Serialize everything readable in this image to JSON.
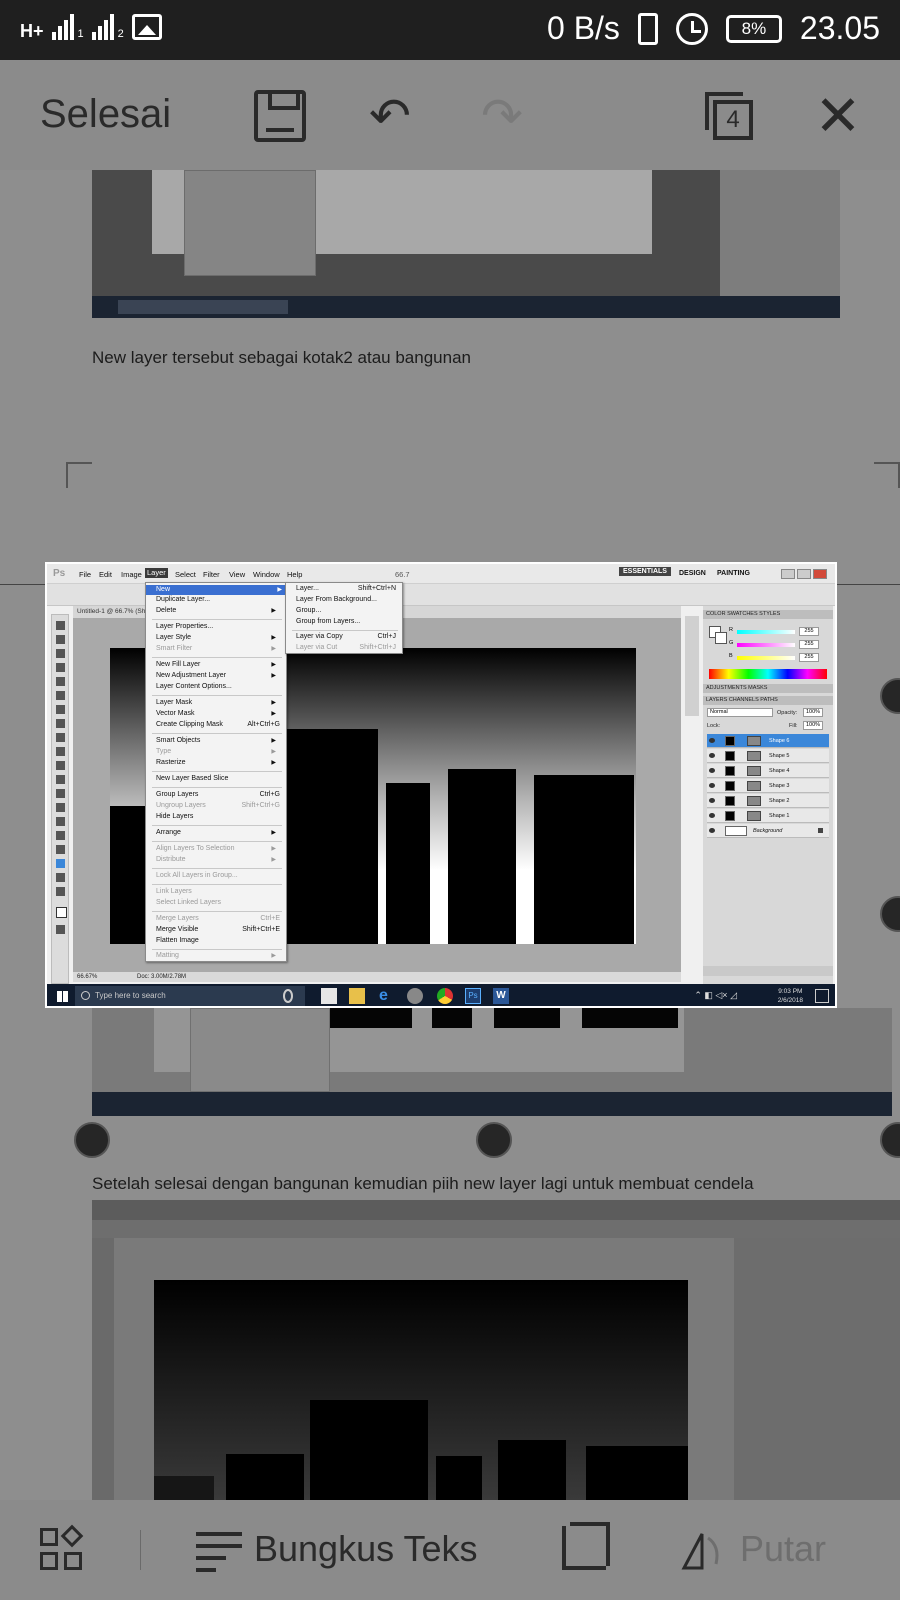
{
  "status_bar": {
    "network": "H+",
    "sim1": "1",
    "sim2": "2",
    "speed": "0 B/s",
    "battery": "8%",
    "time": "23.05"
  },
  "toolbar": {
    "done_label": "Selesai",
    "page_count": "4"
  },
  "document": {
    "caption_1": "New layer tersebut sebagai kotak2 atau bangunan",
    "caption_2": "Setelah selesai dengan bangunan kemudian piih new layer lagi untuk membuat cendela"
  },
  "photoshop": {
    "logo": "Ps",
    "menus": [
      "File",
      "Edit",
      "Image",
      "Layer",
      "Select",
      "Filter",
      "View",
      "Window",
      "Help"
    ],
    "active_menu": "Layer",
    "zoom_value": "66.7",
    "workspaces": [
      "ESSENTIALS",
      "DESIGN",
      "PAINTING"
    ],
    "doc_tab": "Untitled-1 @ 66.7% (Sh",
    "status_zoom": "66.67%",
    "status_doc": "Doc: 3.00M/2.78M",
    "layer_menu": [
      {
        "label": "New",
        "arrow": true,
        "highlight": true
      },
      {
        "label": "Duplicate Layer...",
        "arrow": false
      },
      {
        "label": "Delete",
        "arrow": true
      },
      {
        "label": "Layer Properties..."
      },
      {
        "label": "Layer Style",
        "arrow": true
      },
      {
        "label": "Smart Filter",
        "arrow": true,
        "disabled": true
      },
      {
        "label": "New Fill Layer",
        "arrow": true
      },
      {
        "label": "New Adjustment Layer",
        "arrow": true
      },
      {
        "label": "Layer Content Options..."
      },
      {
        "label": "Layer Mask",
        "arrow": true
      },
      {
        "label": "Vector Mask",
        "arrow": true
      },
      {
        "label": "Create Clipping Mask",
        "shortcut": "Alt+Ctrl+G"
      },
      {
        "label": "Smart Objects",
        "arrow": true
      },
      {
        "label": "Type",
        "arrow": true,
        "disabled": true
      },
      {
        "label": "Rasterize",
        "arrow": true
      },
      {
        "label": "New Layer Based Slice"
      },
      {
        "label": "Group Layers",
        "shortcut": "Ctrl+G"
      },
      {
        "label": "Ungroup Layers",
        "shortcut": "Shift+Ctrl+G",
        "disabled": true
      },
      {
        "label": "Hide Layers"
      },
      {
        "label": "Arrange",
        "arrow": true
      },
      {
        "label": "Align Layers To Selection",
        "arrow": true,
        "disabled": true
      },
      {
        "label": "Distribute",
        "arrow": true,
        "disabled": true
      },
      {
        "label": "Lock All Layers in Group...",
        "disabled": true
      },
      {
        "label": "Link Layers",
        "disabled": true
      },
      {
        "label": "Select Linked Layers",
        "disabled": true
      },
      {
        "label": "Merge Layers",
        "shortcut": "Ctrl+E",
        "disabled": true
      },
      {
        "label": "Merge Visible",
        "shortcut": "Shift+Ctrl+E"
      },
      {
        "label": "Flatten Image"
      },
      {
        "label": "Matting",
        "arrow": true,
        "disabled": true
      }
    ],
    "new_submenu": [
      {
        "label": "Layer...",
        "shortcut": "Shift+Ctrl+N"
      },
      {
        "label": "Layer From Background..."
      },
      {
        "label": "Group..."
      },
      {
        "label": "Group from Layers..."
      },
      {
        "label": "Layer via Copy",
        "shortcut": "Ctrl+J"
      },
      {
        "label": "Layer via Cut",
        "shortcut": "Shift+Ctrl+J",
        "disabled": true
      }
    ],
    "panels": {
      "color_tabs": "COLOR   SWATCHES   STYLES",
      "r_label": "R",
      "g_label": "G",
      "b_label": "B",
      "r": "255",
      "g": "255",
      "b": "255",
      "adj_tabs": "ADJUSTMENTS   MASKS",
      "layers_tabs": "LAYERS   CHANNELS   PATHS",
      "blend_mode": "Normal",
      "opacity_label": "Opacity:",
      "opacity": "100%",
      "lock_label": "Lock:",
      "fill_label": "Fill:",
      "fill": "100%",
      "layers": [
        "Shape 6",
        "Shape 5",
        "Shape 4",
        "Shape 3",
        "Shape 2",
        "Shape 1",
        "Background"
      ],
      "selected_layer": "Shape 6"
    },
    "taskbar": {
      "search_placeholder": "Type here to search",
      "time": "9:03 PM",
      "date": "2/6/2018"
    }
  },
  "bottom_bar": {
    "wrap_label": "Bungkus Teks",
    "rotate_label": "Putar"
  },
  "colors": {
    "status_bar": "#1f1f1f",
    "dim_overlay": "#8e8e8e",
    "highlight": "#3a6fd1",
    "selected_layer": "#3b87d9",
    "taskbar": "#0f1b2e"
  }
}
